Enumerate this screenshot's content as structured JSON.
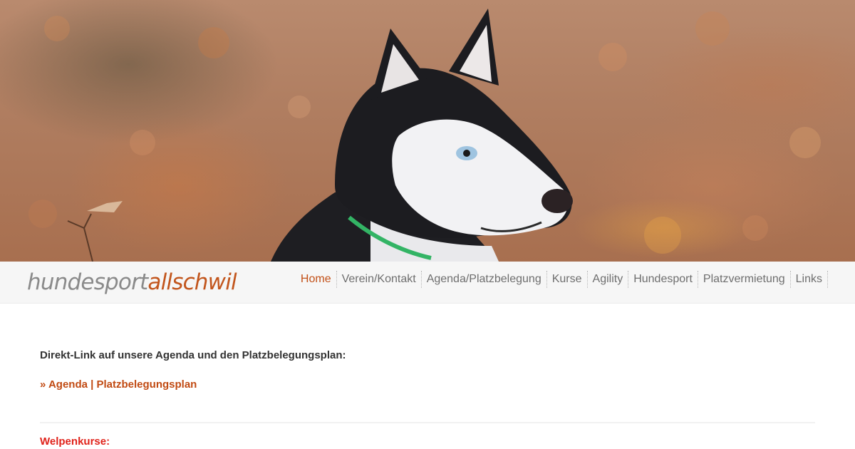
{
  "hero": {
    "image": "siberian husky in autumn leaves"
  },
  "header": {
    "logo": {
      "part1": "hundesport",
      "part2": "allschwil"
    },
    "menu": [
      {
        "label": "Home",
        "active": true
      },
      {
        "label": "Verein/Kontakt",
        "active": false
      },
      {
        "label": "Agenda/Platzbelegung",
        "active": false
      },
      {
        "label": "Kurse",
        "active": false
      },
      {
        "label": "Agility",
        "active": false
      },
      {
        "label": "Hundesport",
        "active": false
      },
      {
        "label": "Platzvermietung",
        "active": false
      },
      {
        "label": "Links",
        "active": false
      }
    ]
  },
  "main": {
    "intro": "Direkt-Link auf unsere Agenda und den Platzbelegungsplan:",
    "agenda_link": "» Agenda | Platzbelegungsplan",
    "section_title": "Welpenkurse:"
  },
  "colors": {
    "accent": "#c25018",
    "section_red": "#e0231b",
    "text": "#333333",
    "nav_bg": "#f6f6f6"
  }
}
